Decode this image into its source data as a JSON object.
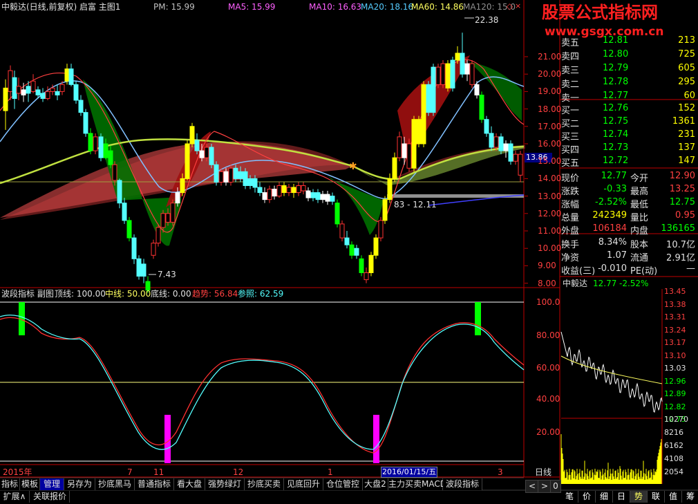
{
  "header": {
    "title": "中毅达(日线,前复权) 启富 主图1",
    "pm": "PM: 15.99",
    "pm_val": "15.99",
    "ma5": "MA5: 15.99",
    "ma10": "MA10: 16.63",
    "ma20": "MA20: 18.16",
    "ma60": "MA60: 14.86",
    "ma120": "MA120: 15.0"
  },
  "watermark": {
    "line1": "股票公式指标网",
    "line2": "www.gsgx.com.cn"
  },
  "main_chart": {
    "price_axis": [
      "21.00",
      "20.00",
      "19.00",
      "18.00",
      "17.00",
      "16.00",
      "15.00",
      "14.00",
      "13.00",
      "12.00",
      "11.00",
      "10.00",
      "9.00",
      "8.00"
    ],
    "annotations": {
      "high": "22.38",
      "low": "7.43",
      "mid_low": "83 - 12.11",
      "current_price_tag": "13.86"
    }
  },
  "sub_chart": {
    "legend": {
      "name": "波段指标 副图",
      "top": "顶线: 100.00",
      "mid": "中线: 50.00",
      "bottom": "底线: 0.00",
      "trend": "趋势: 56.84",
      "ref": "参照: 62.59"
    },
    "axis": [
      "100.0",
      "80.00",
      "60.00",
      "40.00",
      "20.00"
    ]
  },
  "date_axis": {
    "labels": [
      "2015年",
      "7",
      "11",
      "12",
      "1",
      "3"
    ],
    "cursor": "2016/01/15/五"
  },
  "order_book": {
    "asks": [
      {
        "label": "卖五",
        "price": "12.81",
        "vol": "213"
      },
      {
        "label": "卖四",
        "price": "12.80",
        "vol": "725"
      },
      {
        "label": "卖三",
        "price": "12.79",
        "vol": "605"
      },
      {
        "label": "卖二",
        "price": "12.78",
        "vol": "295"
      },
      {
        "label": "卖一",
        "price": "12.77",
        "vol": "60"
      }
    ],
    "bids": [
      {
        "label": "买一",
        "price": "12.76",
        "vol": "152"
      },
      {
        "label": "买二",
        "price": "12.75",
        "vol": "1361"
      },
      {
        "label": "买三",
        "price": "12.74",
        "vol": "231"
      },
      {
        "label": "买四",
        "price": "12.73",
        "vol": "137"
      },
      {
        "label": "买五",
        "price": "12.72",
        "vol": "147"
      }
    ]
  },
  "stats": [
    {
      "l1": "现价",
      "v1": "12.77",
      "l2": "今开",
      "v2": "12.90"
    },
    {
      "l1": "涨跌",
      "v1": "-0.33",
      "l2": "最高",
      "v2": "13.25"
    },
    {
      "l1": "涨幅",
      "v1": "-2.52%",
      "l2": "最低",
      "v2": "12.75"
    },
    {
      "l1": "总量",
      "v1": "242349",
      "l2": "量比",
      "v2": "0.95"
    },
    {
      "l1": "外盘",
      "v1": "106184",
      "l2": "内盘",
      "v2": "136165"
    }
  ],
  "stats2": [
    {
      "l1": "换手",
      "v1": "8.34%",
      "l2": "股本",
      "v2": "10.7亿"
    },
    {
      "l1": "净资",
      "v1": "1.07",
      "l2": "流通",
      "v2": "2.91亿"
    },
    {
      "l1": "收益(三)",
      "v1": "-0.010",
      "l2": "PE(动)",
      "v2": "—"
    }
  ],
  "mini_chart": {
    "title": "中毅达",
    "price": "12.77",
    "pct": "-2.52%",
    "axis": [
      "13.45",
      "13.38",
      "13.31",
      "13.24",
      "13.17",
      "13.10",
      "13.03",
      "12.96",
      "12.89",
      "12.82",
      "12.75"
    ],
    "vol_axis": [
      "10270",
      "8216",
      "6162",
      "4108",
      "2054"
    ]
  },
  "bottom_tabs": [
    "指标",
    "模板",
    "管理",
    "另存为",
    "抄底黑马",
    "普通指标",
    "看大盘",
    "强势绿灯",
    "抄底买卖",
    "见底回升",
    "仓位管控",
    "大盘2",
    "主力买卖MACD",
    "波段指标"
  ],
  "bottom_tabs2": [
    "扩展∧",
    "关联报价"
  ],
  "period": "日线",
  "nav_arrows": [
    "<",
    ">",
    "0"
  ],
  "side_tabs": [
    "笔",
    "价",
    "细",
    "日",
    "势",
    "联",
    "值",
    "筹"
  ],
  "colors": {
    "up": "#ff3232",
    "down": "#00ff00",
    "cyan": "#54ffff",
    "yellow": "#ffff00",
    "magenta": "#ff00ff",
    "grid": "#800000",
    "axis": "#c00000"
  }
}
